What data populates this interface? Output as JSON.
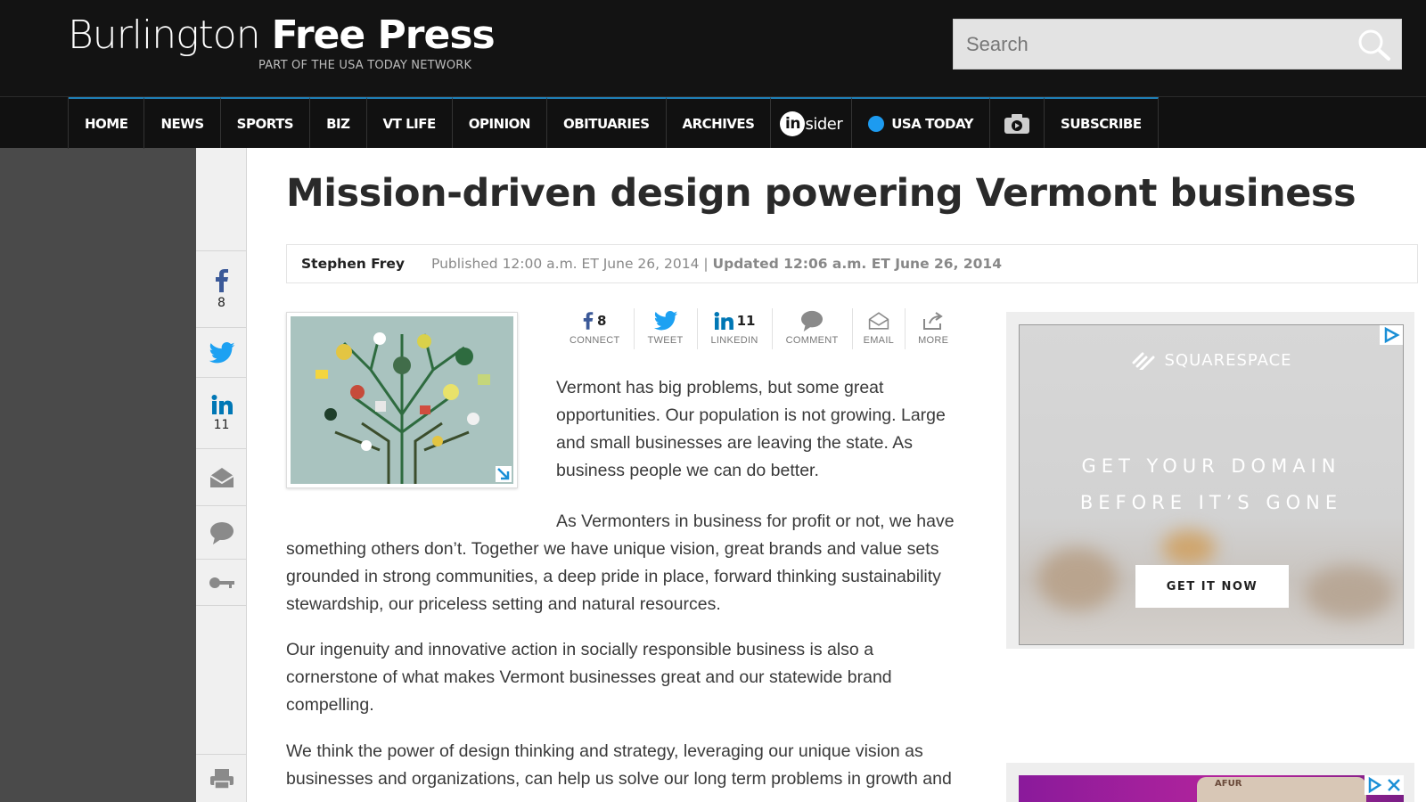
{
  "header": {
    "logo_light": "Burlington",
    "logo_bold": "Free Press",
    "logo_sub": "PART OF THE USA TODAY NETWORK",
    "search_placeholder": "Search"
  },
  "nav": {
    "items": [
      "HOME",
      "NEWS",
      "SPORTS",
      "BIZ",
      "VT LIFE",
      "OPINION",
      "OBITUARIES",
      "ARCHIVES"
    ],
    "insider_in": "in",
    "insider_rest": "sider",
    "usa_today": "USA TODAY",
    "subscribe": "SUBSCRIBE"
  },
  "rail": {
    "facebook_count": "8",
    "linkedin_count": "11"
  },
  "article": {
    "headline": "Mission-driven design powering Vermont business",
    "author": "Stephen Frey",
    "published": "Published 12:00 a.m. ET June 26, 2014 | ",
    "updated": "Updated 12:06 a.m. ET June 26, 2014",
    "paragraphs": [
      "Vermont has big problems, but some great opportunities. Our population is not growing. Large and small businesses are leaving the state. As business people we can do better.",
      "As Vermonters in business for profit or not, we have something others don’t. Together we have unique vision, great brands and value sets grounded in strong communities, a deep pride in place, forward thinking sustainability stewardship, our priceless setting and natural resources.",
      "Our ingenuity and innovative action in socially responsible business is also a cornerstone of what makes Vermont businesses great and our statewide brand compelling.",
      "We think the power of design thinking and strategy, leveraging our unique vision as businesses and organizations, can help us solve our long term problems in growth and"
    ]
  },
  "share": {
    "facebook_count": "8",
    "facebook_label": "CONNECT",
    "twitter_label": "TWEET",
    "linkedin_count": "11",
    "linkedin_label": "LINKEDIN",
    "comment_label": "COMMENT",
    "email_label": "EMAIL",
    "more_label": "MORE"
  },
  "ad1": {
    "brand": "SQUARESPACE",
    "headline_line1": "GET YOUR DOMAIN",
    "headline_line2": "BEFORE IT’S GONE",
    "cta": "GET IT NOW"
  },
  "ad2": {
    "label": "AFUR"
  },
  "colors": {
    "header_bg": "#131313",
    "nav_accent": "#1f7fb7",
    "facebook": "#3b5998",
    "twitter": "#1da1f2",
    "linkedin": "#0077b5",
    "usa_today_blue": "#1d9bf0"
  }
}
